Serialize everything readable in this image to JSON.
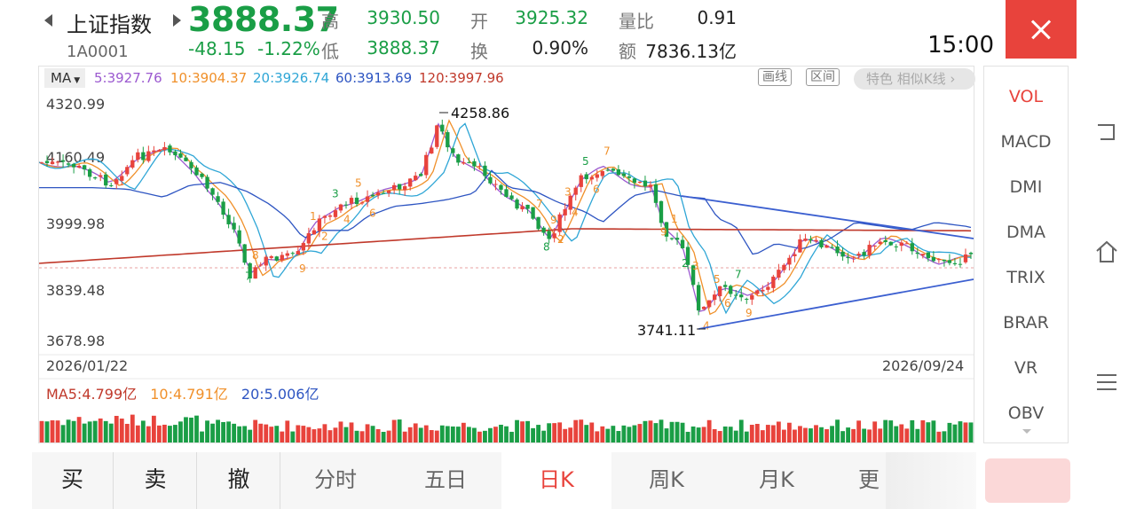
{
  "header": {
    "name": "上证指数",
    "code": "1A0001",
    "price": "3888.37",
    "change": "-48.15",
    "change_pct": "-1.22%",
    "high_label": "高",
    "high": "3930.50",
    "low_label": "低",
    "low": "3888.37",
    "open_label": "开",
    "open": "3925.32",
    "turnover_label": "换",
    "turnover": "0.90%",
    "volume_ratio_label": "量比",
    "volume_ratio": "0.91",
    "amount_label": "额",
    "amount": "7836.13亿",
    "time": "15:00"
  },
  "colors": {
    "up": "#e8433c",
    "down": "#1a9e46",
    "ma5": "#9b59d0",
    "ma10": "#f0902a",
    "ma20": "#2fa6d6",
    "ma60": "#2e55c2",
    "ma120": "#c0392b"
  },
  "ma_bar": {
    "selector": "MA",
    "ma5": "5:3927.76",
    "ma10": "10:3904.37",
    "ma20": "20:3926.74",
    "ma60": "60:3913.69",
    "ma120": "120:3997.96",
    "btn_draw": "画线",
    "btn_range": "区间",
    "btn_feature": "特色  相似K线 ›"
  },
  "chart": {
    "y_labels": [
      "4320.99",
      "4160.49",
      "3999.98",
      "3839.48",
      "3678.98"
    ],
    "date_start": "2026/01/22",
    "date_end": "2026/09/24",
    "high_mark": "4258.86",
    "low_mark": "3741.11",
    "td_digits": [
      "7",
      "8",
      "9",
      "1",
      "2",
      "3",
      "4",
      "5",
      "6",
      "7",
      "8",
      "9",
      "2",
      "3",
      "4",
      "5",
      "6",
      "7",
      "9",
      "1",
      "2",
      "3",
      "4",
      "5",
      "6",
      "7",
      "9"
    ]
  },
  "volume_bar": {
    "ma5": "MA5:4.799亿",
    "ma10": "10:4.791亿",
    "ma20": "20:5.006亿"
  },
  "indicators": {
    "items": [
      "VOL",
      "MACD",
      "DMI",
      "DMA",
      "TRIX",
      "BRAR",
      "VR",
      "OBV"
    ],
    "selected": "VOL"
  },
  "bottom_bar": {
    "buy": "买",
    "sell": "卖",
    "cancel": "撤",
    "tabs": [
      "分时",
      "五日",
      "日K",
      "周K",
      "月K",
      "更"
    ],
    "active_tab": "日K"
  }
}
